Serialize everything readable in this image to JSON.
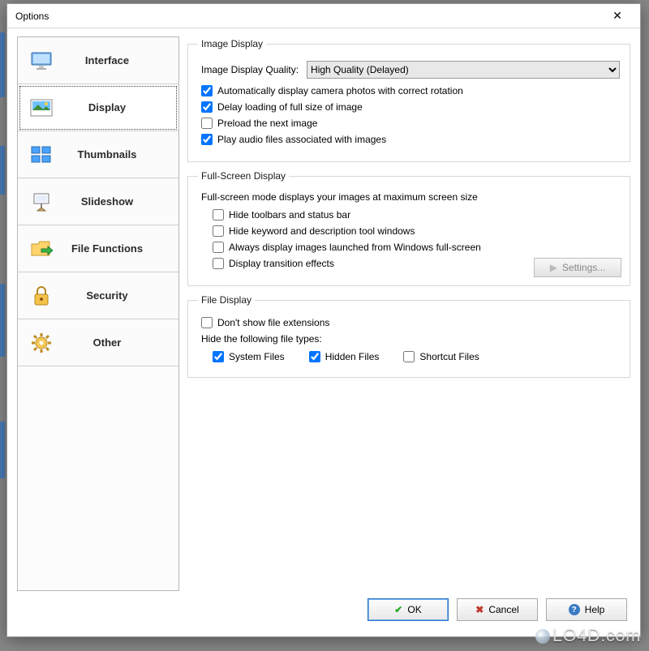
{
  "window": {
    "title": "Options"
  },
  "sidebar": {
    "items": [
      {
        "label": "Interface"
      },
      {
        "label": "Display"
      },
      {
        "label": "Thumbnails"
      },
      {
        "label": "Slideshow"
      },
      {
        "label": "File Functions"
      },
      {
        "label": "Security"
      },
      {
        "label": "Other"
      }
    ],
    "active_index": 1
  },
  "groups": {
    "image_display": {
      "legend": "Image Display",
      "quality_label": "Image Display Quality:",
      "quality_value": "High Quality (Delayed)",
      "auto_rotate": "Automatically display camera photos with correct rotation",
      "delay_load": "Delay loading of full size of image",
      "preload": "Preload the next image",
      "play_audio": "Play audio files associated with images"
    },
    "fullscreen": {
      "legend": "Full-Screen Display",
      "note": "Full-screen mode displays your images at maximum screen size",
      "hide_toolbars": "Hide toolbars and status bar",
      "hide_keyword": "Hide keyword and description tool windows",
      "always_fs": "Always display images launched from Windows full-screen",
      "transition": "Display transition effects",
      "settings_btn": "Settings..."
    },
    "file_display": {
      "legend": "File Display",
      "hide_ext": "Don't show file extensions",
      "hide_types_label": "Hide the following file types:",
      "system": "System Files",
      "hidden": "Hidden Files",
      "shortcut": "Shortcut Files"
    }
  },
  "footer": {
    "ok": "OK",
    "cancel": "Cancel",
    "help": "Help"
  },
  "watermark": "LO4D.com"
}
